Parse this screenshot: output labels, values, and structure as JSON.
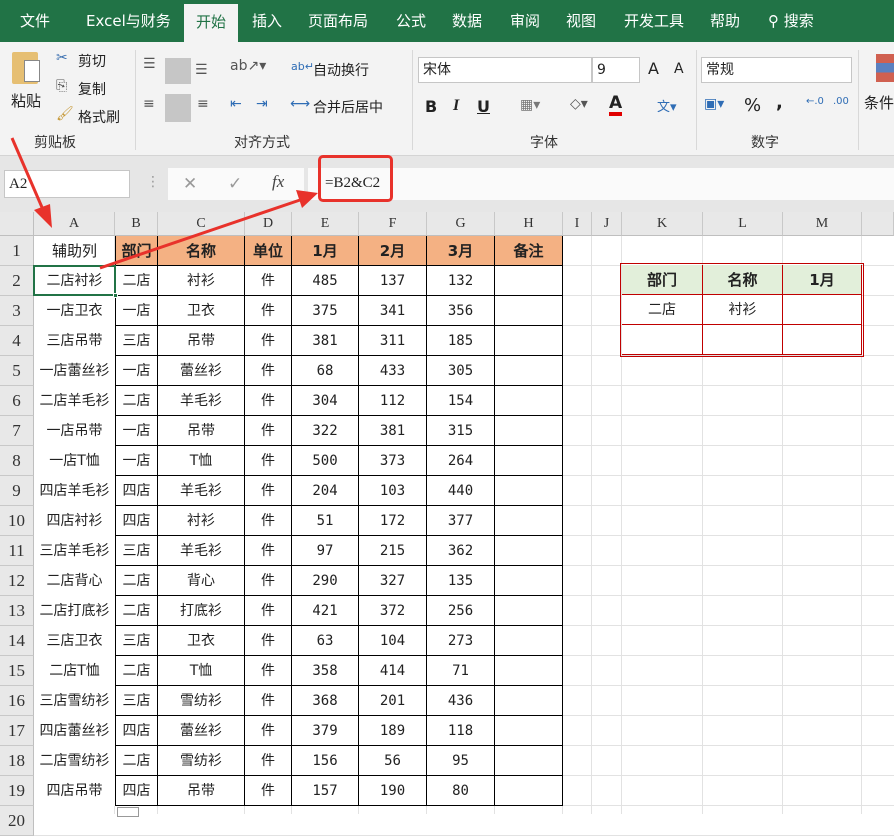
{
  "tabs": [
    {
      "label": "文件"
    },
    {
      "label": "Excel与财务"
    },
    {
      "label": "开始",
      "active": true
    },
    {
      "label": "插入"
    },
    {
      "label": "页面布局"
    },
    {
      "label": "公式"
    },
    {
      "label": "数据"
    },
    {
      "label": "审阅"
    },
    {
      "label": "视图"
    },
    {
      "label": "开发工具"
    },
    {
      "label": "帮助"
    },
    {
      "label": "搜索",
      "icon": "search-icon"
    }
  ],
  "ribbon": {
    "clipboard": {
      "paste": "粘贴",
      "cut": "剪切",
      "copy": "复制",
      "format_painter": "格式刷",
      "group": "剪贴板"
    },
    "alignment": {
      "wrap": "自动换行",
      "merge": "合并后居中",
      "group": "对齐方式"
    },
    "font": {
      "name": "宋体",
      "size": "9",
      "bold": "B",
      "italic": "I",
      "underline": "U",
      "group": "字体",
      "font_color": "#e00000"
    },
    "number": {
      "format": "常规",
      "percent": "%",
      "comma": ",",
      "group": "数字"
    },
    "styles": {
      "conditional": "条件"
    }
  },
  "formula_bar": {
    "name_box": "A2",
    "formula": "=B2&C2",
    "fx": "fx"
  },
  "columns": [
    "A",
    "B",
    "C",
    "D",
    "E",
    "F",
    "G",
    "H",
    "I",
    "J",
    "K",
    "L",
    "M"
  ],
  "headers": [
    "辅助列",
    "部门",
    "名称",
    "单位",
    "1月",
    "2月",
    "3月",
    "备注"
  ],
  "rows": [
    [
      "二店衬衫",
      "二店",
      "衬衫",
      "件",
      "485",
      "137",
      "132",
      ""
    ],
    [
      "一店卫衣",
      "一店",
      "卫衣",
      "件",
      "375",
      "341",
      "356",
      ""
    ],
    [
      "三店吊带",
      "三店",
      "吊带",
      "件",
      "381",
      "311",
      "185",
      ""
    ],
    [
      "一店蕾丝衫",
      "一店",
      "蕾丝衫",
      "件",
      "68",
      "433",
      "305",
      ""
    ],
    [
      "二店羊毛衫",
      "二店",
      "羊毛衫",
      "件",
      "304",
      "112",
      "154",
      ""
    ],
    [
      "一店吊带",
      "一店",
      "吊带",
      "件",
      "322",
      "381",
      "315",
      ""
    ],
    [
      "一店T恤",
      "一店",
      "T恤",
      "件",
      "500",
      "373",
      "264",
      ""
    ],
    [
      "四店羊毛衫",
      "四店",
      "羊毛衫",
      "件",
      "204",
      "103",
      "440",
      ""
    ],
    [
      "四店衬衫",
      "四店",
      "衬衫",
      "件",
      "51",
      "172",
      "377",
      ""
    ],
    [
      "三店羊毛衫",
      "三店",
      "羊毛衫",
      "件",
      "97",
      "215",
      "362",
      ""
    ],
    [
      "二店背心",
      "二店",
      "背心",
      "件",
      "290",
      "327",
      "135",
      ""
    ],
    [
      "二店打底衫",
      "二店",
      "打底衫",
      "件",
      "421",
      "372",
      "256",
      ""
    ],
    [
      "三店卫衣",
      "三店",
      "卫衣",
      "件",
      "63",
      "104",
      "273",
      ""
    ],
    [
      "二店T恤",
      "二店",
      "T恤",
      "件",
      "358",
      "414",
      "71",
      ""
    ],
    [
      "三店雪纺衫",
      "三店",
      "雪纺衫",
      "件",
      "368",
      "201",
      "436",
      ""
    ],
    [
      "四店蕾丝衫",
      "四店",
      "蕾丝衫",
      "件",
      "379",
      "189",
      "118",
      ""
    ],
    [
      "二店雪纺衫",
      "二店",
      "雪纺衫",
      "件",
      "156",
      "56",
      "95",
      ""
    ],
    [
      "四店吊带",
      "四店",
      "吊带",
      "件",
      "157",
      "190",
      "80",
      ""
    ]
  ],
  "lookup": {
    "headers": [
      "部门",
      "名称",
      "1月"
    ],
    "rows": [
      [
        "二店",
        "衬衫",
        ""
      ],
      [
        "",
        "",
        ""
      ]
    ]
  },
  "colors": {
    "header_fill": "#f4b183",
    "lookup_header_fill": "#e2efda",
    "accent": "#217346",
    "annotation": "#e8322b"
  }
}
